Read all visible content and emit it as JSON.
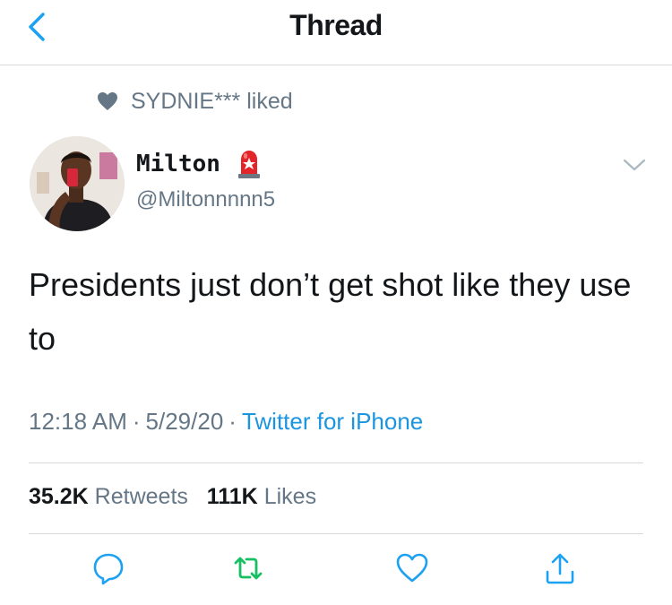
{
  "header": {
    "title": "Thread",
    "back_icon": "chevron-left-icon"
  },
  "social_context": {
    "icon": "heart-icon",
    "text": "SYDNIE*** liked"
  },
  "tweet": {
    "author": {
      "name": "Milton",
      "badge_icon": "siren-emoji-icon",
      "handle": "@Miltonnnnn5"
    },
    "text": "Presidents just don’t get shot like they use to",
    "time": "12:18 AM",
    "date": "5/29/20",
    "source": "Twitter for iPhone",
    "separator": "·"
  },
  "stats": {
    "retweets_count": "35.2K",
    "retweets_label": "Retweets",
    "likes_count": "111K",
    "likes_label": "Likes"
  },
  "actions": [
    "reply-icon",
    "retweet-icon",
    "like-icon",
    "share-icon"
  ],
  "colors": {
    "accent": "#1da1f2",
    "retweet": "#17bf63",
    "muted": "#657786",
    "text": "#14171a"
  }
}
